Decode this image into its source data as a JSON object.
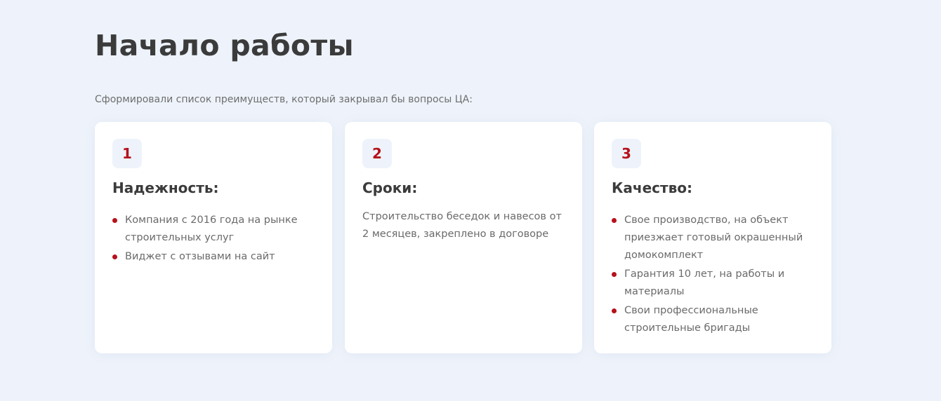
{
  "page": {
    "title": "Начало работы",
    "subtitle": "Сформировали список преимуществ, который закрывал бы вопросы ЦА:"
  },
  "accent_color": "#b5121b",
  "background_color": "#eef3fb",
  "cards": [
    {
      "number": "1",
      "title": "Надежность:",
      "items": [
        "Компания с 2016 года на рынке строительных услуг",
        "Виджет с отзывами на сайт"
      ]
    },
    {
      "number": "2",
      "title": "Сроки:",
      "text": "Строительство беседок и навесов от 2 месяцев, закреплено в договоре"
    },
    {
      "number": "3",
      "title": "Качество:",
      "items": [
        "Свое производство, на объект приезжает готовый окрашенный домокомплект",
        "Гарантия 10 лет, на работы и материалы",
        "Свои профессиональные строительные бригады"
      ]
    }
  ]
}
